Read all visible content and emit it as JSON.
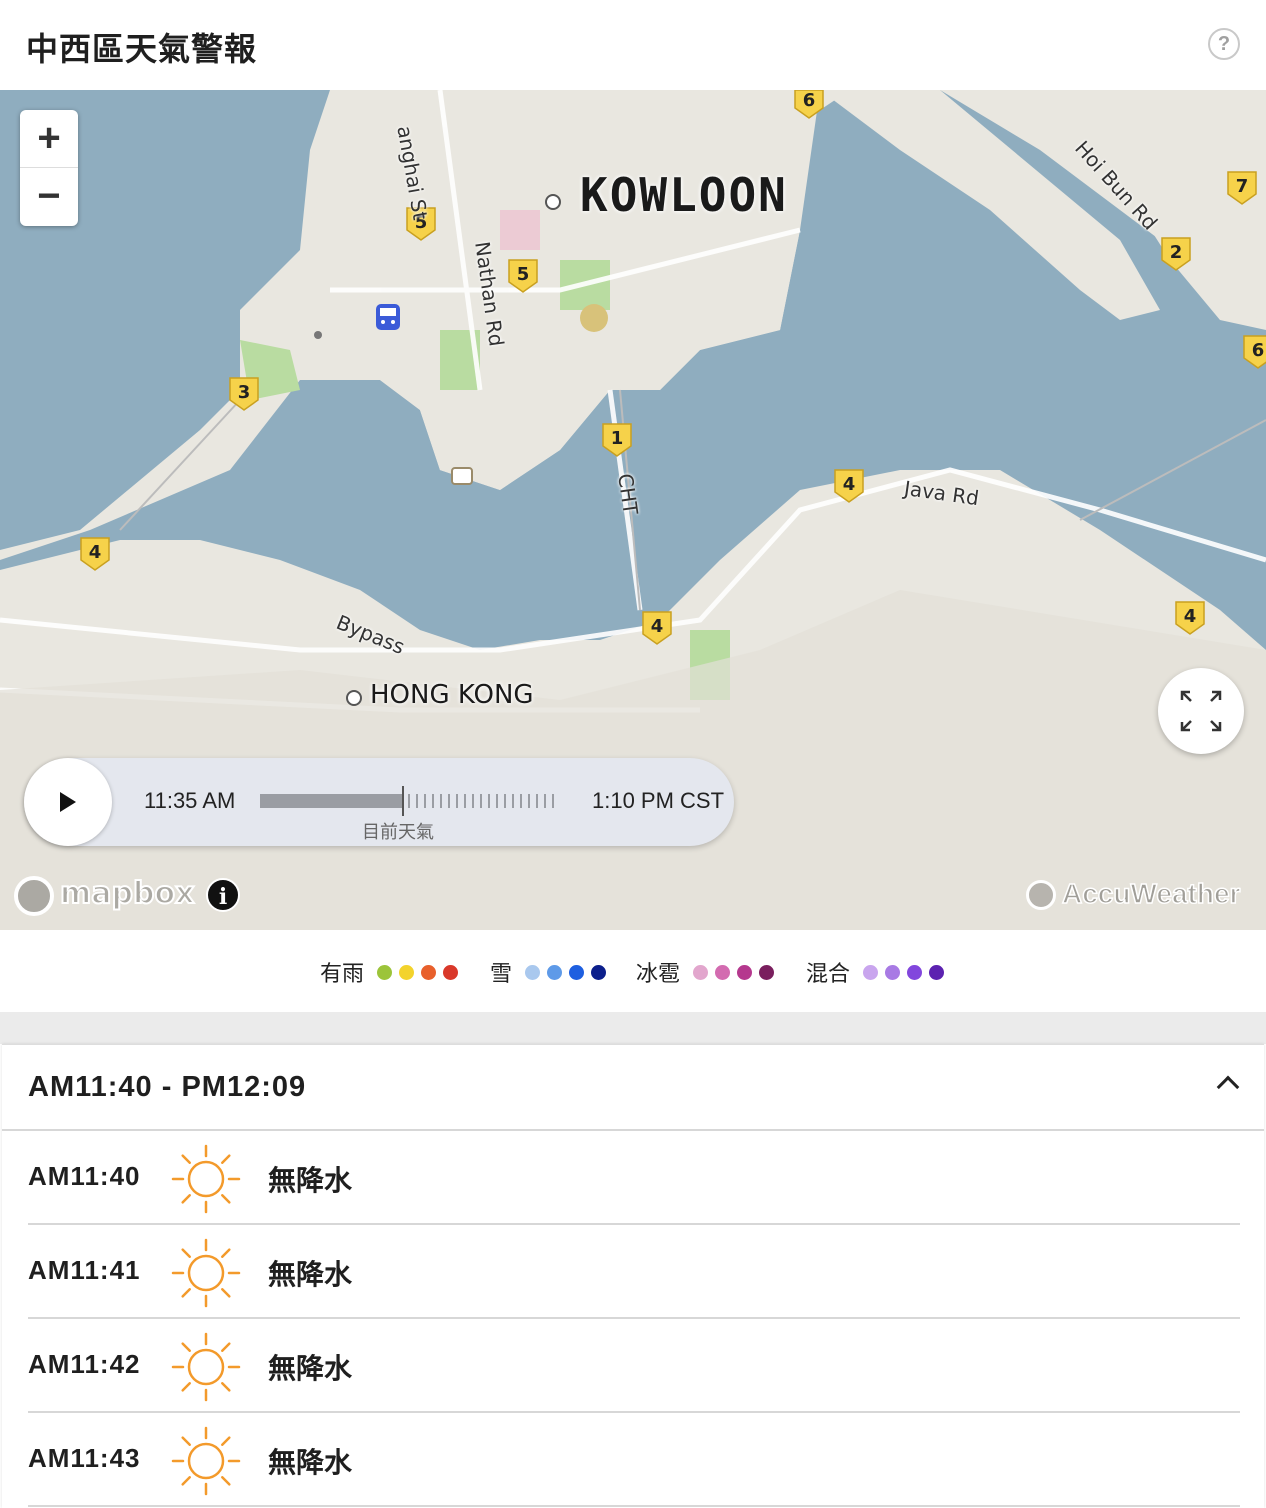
{
  "header": {
    "title": "中西區天氣警報",
    "help_symbol": "?"
  },
  "map": {
    "zoom_in": "+",
    "zoom_out": "−",
    "labels": {
      "kowloon": "KOWLOON",
      "hong_kong": "HONG KONG",
      "shanghai_st": "anghai St",
      "nathan_rd": "Nathan Rd",
      "cht": "CHT",
      "java_rd": "Java Rd",
      "bypass": "Bypass",
      "hoi_bun_rd": "Hoi Bun Rd"
    },
    "route_shields": [
      "6",
      "7",
      "5",
      "5",
      "2",
      "6",
      "3",
      "1",
      "4",
      "4",
      "4",
      "4"
    ],
    "attribution": {
      "mapbox": "mapbox",
      "info_symbol": "i",
      "accuweather": "AccuWeather"
    },
    "colors": {
      "water": "#8fadbf",
      "land": "#e9e7e0",
      "park": "#b9dca1",
      "shield": "#f6d24a"
    }
  },
  "timeline": {
    "start_time": "11:35 AM",
    "end_time": "1:10 PM CST",
    "now_label": "目前天氣",
    "progress": 0.48
  },
  "legend": [
    {
      "label": "有雨",
      "colors": [
        "#9cc43a",
        "#f3d32c",
        "#e8602c",
        "#d9382a"
      ]
    },
    {
      "label": "雪",
      "colors": [
        "#a9c8ee",
        "#5e9ae8",
        "#1e5fe0",
        "#0c1f8c"
      ]
    },
    {
      "label": "冰雹",
      "colors": [
        "#e2a6cd",
        "#d36bb0",
        "#b5388e",
        "#7a1f5e"
      ]
    },
    {
      "label": "混合",
      "colors": [
        "#c9a5ee",
        "#a87ae4",
        "#8246dd",
        "#5c22b0"
      ]
    }
  ],
  "forecast": {
    "range_label": "AM11:40 - PM12:09",
    "rows": [
      {
        "time": "AM11:40",
        "icon": "sun-icon",
        "condition": "無降水"
      },
      {
        "time": "AM11:41",
        "icon": "sun-icon",
        "condition": "無降水"
      },
      {
        "time": "AM11:42",
        "icon": "sun-icon",
        "condition": "無降水"
      },
      {
        "time": "AM11:43",
        "icon": "sun-icon",
        "condition": "無降水"
      }
    ],
    "icon_color": "#f39a2b"
  }
}
